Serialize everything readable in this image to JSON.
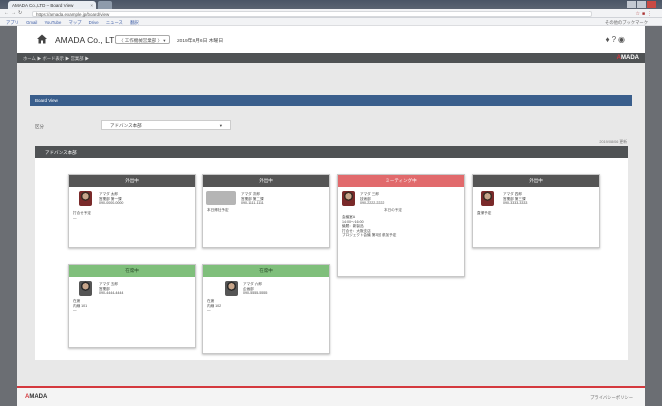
{
  "browser": {
    "tab_title": "AMADA Co.,LTD – Board View",
    "url": "https://amada.example.jp/board/view",
    "bookmarks": [
      "アプリ",
      "Gmail",
      "YouTube",
      "マップ",
      "Drive",
      "ニュース",
      "翻訳"
    ],
    "other_bookmarks": "その他のブックマーク"
  },
  "header": {
    "company": "AMADA Co., LTD",
    "select_label": "〈 工作機械営業部 〉 ▾",
    "date_text": "2019年8月6日 木曜日",
    "icons": [
      "home-icon",
      "help-icon",
      "user-icon"
    ]
  },
  "subnav": {
    "crumbs": "ホーム ▶ ボード表示 ▶ 営業部 ▶",
    "brand_mark": "A",
    "brand_rest": "MADA"
  },
  "section": {
    "title": "Board View"
  },
  "filter": {
    "label": "区分",
    "value": "アドバンス本部",
    "caret": "▾"
  },
  "note": "2019/08/06 更新",
  "panel": {
    "title": "アドバンス本部"
  },
  "cards": [
    {
      "status": "gray",
      "head": "外出中",
      "info": [
        "アマダ 太郎",
        "営業部 第一課",
        "090-0000-0000"
      ],
      "desc": [
        "打合せ予定",
        "—"
      ],
      "banner": ""
    },
    {
      "status": "gray",
      "head": "外出中",
      "info": [
        "アマダ 次郎",
        "営業部 第二課",
        "090-1111-1111"
      ],
      "desc": [
        "本日帰社予定"
      ],
      "banner": ""
    },
    {
      "status": "red",
      "head": "ミーティング中",
      "info": [
        "アマダ 三郎",
        "技術部",
        "090-2222-2222"
      ],
      "desc": [
        "会議室A",
        "14:00〜16:00",
        "議題：新製品",
        "打合せ：大阪支店",
        "プロジェクト会議 第3回 参加予定"
      ],
      "banner": "本日の予定"
    },
    {
      "status": "gray",
      "head": "外出中",
      "info": [
        "アマダ 四郎",
        "営業部 第三課",
        "090-3333-3333"
      ],
      "desc": [
        "直帰予定"
      ],
      "banner": ""
    },
    {
      "status": "green",
      "head": "在席中",
      "info": [
        "アマダ 五郎",
        "営業部",
        "090-4444-4444"
      ],
      "desc": [
        "在席",
        "内線 101",
        "—"
      ],
      "banner": ""
    },
    {
      "status": "green",
      "head": "在席中",
      "info": [
        "アマダ 六郎",
        "企画部",
        "090-5555-5555"
      ],
      "desc": [
        "在席",
        "内線 102",
        "—"
      ],
      "banner": ""
    }
  ],
  "footer": {
    "logo_mark": "A",
    "logo_rest": "MADA",
    "right_text": "プライバシーポリシー"
  },
  "colors": {
    "section_blue": "#3a5e8c",
    "status_red": "#e16a6c",
    "status_green": "#7fbf7b",
    "status_gray": "#555555",
    "brand_red": "#d4393e"
  }
}
